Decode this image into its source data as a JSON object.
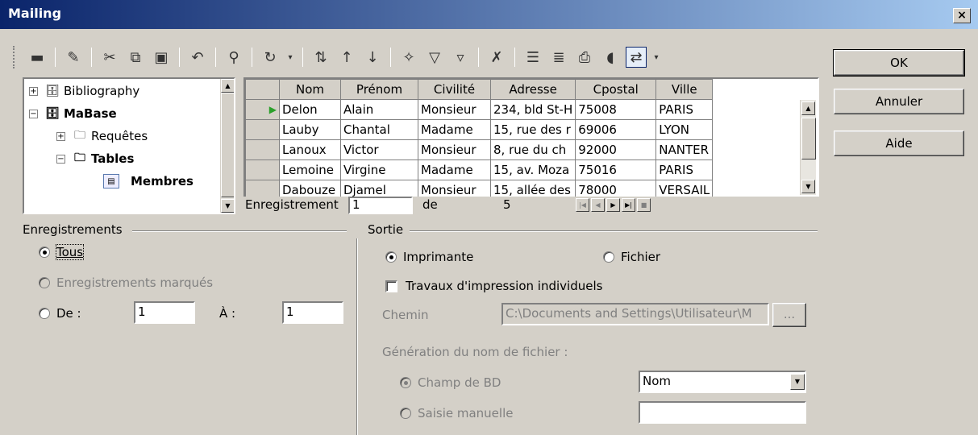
{
  "window": {
    "title": "Mailing",
    "close": "×"
  },
  "buttons": {
    "ok": "OK",
    "cancel": "Annuler",
    "help": "Aide",
    "browse": "..."
  },
  "tree": {
    "items": [
      {
        "label": "Bibliography",
        "expander": "+",
        "bold": false
      },
      {
        "label": "MaBase",
        "expander": "−",
        "bold": true
      },
      {
        "label": "Requêtes",
        "expander": "+",
        "bold": false
      },
      {
        "label": "Tables",
        "expander": "−",
        "bold": true
      },
      {
        "label": "Membres",
        "expander": "",
        "bold": true
      }
    ]
  },
  "grid": {
    "columns": [
      "Nom",
      "Prénom",
      "Civilité",
      "Adresse",
      "Cpostal",
      "Ville"
    ],
    "rows": [
      [
        "Delon",
        "Alain",
        "Monsieur",
        "234, bld St-H",
        "75008",
        "PARIS"
      ],
      [
        "Lauby",
        "Chantal",
        "Madame",
        "15, rue des r",
        "69006",
        "LYON"
      ],
      [
        "Lanoux",
        "Victor",
        "Monsieur",
        "8, rue du ch",
        "92000",
        "NANTER"
      ],
      [
        "Lemoine",
        "Virgine",
        "Madame",
        "15, av. Moza",
        "75016",
        "PARIS"
      ],
      [
        "Dabouze",
        "Djamel",
        "Monsieur",
        "15, allée des",
        "78000",
        "VERSAIL"
      ]
    ],
    "nav": {
      "label": "Enregistrement",
      "current": "1",
      "of_label": "de",
      "total": "5"
    }
  },
  "records": {
    "group_label": "Enregistrements",
    "all_label": "Tous",
    "marked_label": "Enregistrements marqués",
    "from_label": "De :",
    "to_label": "À :",
    "from_value": "1",
    "to_value": "1"
  },
  "output": {
    "group_label": "Sortie",
    "printer_label": "Imprimante",
    "file_label": "Fichier",
    "individual_jobs_label": "Travaux d'impression individuels",
    "path_label": "Chemin",
    "path_value": "C:\\Documents and Settings\\Utilisateur\\M",
    "filename_gen_label": "Génération du nom de fichier :",
    "db_field_label": "Champ de BD",
    "db_field_value": "Nom",
    "manual_label": "Saisie manuelle",
    "manual_value": ""
  }
}
